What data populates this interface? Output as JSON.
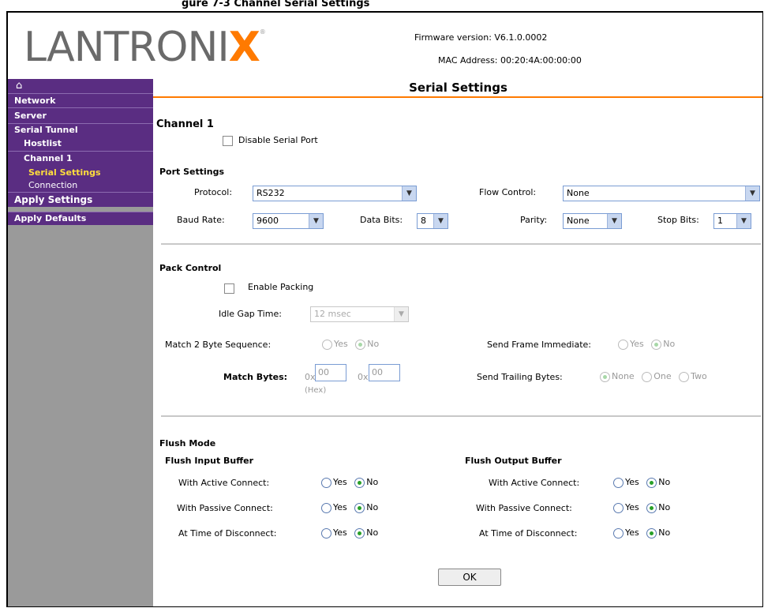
{
  "caption": "gure 7-3 Channel Serial Settings",
  "header": {
    "logo_text": "LANTRONI",
    "logo_x": "X",
    "logo_reg": "®",
    "firmware": "Firmware version: V6.1.0.0002",
    "mac": "MAC Address: 00:20:4A:00:00:00"
  },
  "sidebar": {
    "home_icon": "⌂",
    "items": [
      {
        "label": "Network",
        "level": 0
      },
      {
        "label": "Server",
        "level": 0
      },
      {
        "label": "Serial Tunnel",
        "level": 0
      },
      {
        "label": "Hostlist",
        "level": 1
      },
      {
        "label": "Channel 1",
        "level": 1
      },
      {
        "label": "Serial Settings",
        "level": 2
      },
      {
        "label": "Connection",
        "level": 2
      },
      {
        "label": "Apply Settings",
        "level": 0
      },
      {
        "label": "Apply Defaults",
        "level": 0
      }
    ]
  },
  "page": {
    "title": "Serial Settings",
    "channel": "Channel 1",
    "disable_serial_port": "Disable Serial Port",
    "port_settings": {
      "heading": "Port Settings",
      "protocol_label": "Protocol:",
      "protocol_value": "RS232",
      "flow_label": "Flow Control:",
      "flow_value": "None",
      "baud_label": "Baud Rate:",
      "baud_value": "9600",
      "databits_label": "Data Bits:",
      "databits_value": "8",
      "parity_label": "Parity:",
      "parity_value": "None",
      "stopbits_label": "Stop Bits:",
      "stopbits_value": "1"
    },
    "pack_control": {
      "heading": "Pack Control",
      "enable_packing": "Enable Packing",
      "idle_gap_label": "Idle Gap Time:",
      "idle_gap_value": "12 msec",
      "match_seq_label": "Match 2 Byte Sequence:",
      "yes": "Yes",
      "no": "No",
      "send_frame_label": "Send Frame Immediate:",
      "match_bytes_label": "Match Bytes:",
      "match_bytes_v1": "0x",
      "match_bytes_in1": "00",
      "match_bytes_v2": "0x",
      "match_bytes_in2": "00",
      "match_bytes_hex": "(Hex)",
      "send_trailing_label": "Send Trailing Bytes:",
      "none": "None",
      "one": "One",
      "two": "Two"
    },
    "flush_mode": {
      "heading": "Flush Mode",
      "input_heading": "Flush Input Buffer",
      "output_heading": "Flush Output Buffer",
      "input_rows": [
        {
          "label": "With Active Connect:",
          "yes": "Yes",
          "no": "No"
        },
        {
          "label": "With Passive Connect:",
          "yes": "Yes",
          "no": "No"
        },
        {
          "label": "At Time of Disconnect:",
          "yes": "Yes",
          "no": "No"
        }
      ],
      "output_rows": [
        {
          "label": "With Active Connect:",
          "yes": "Yes",
          "no": "No"
        },
        {
          "label": "With Passive Connect:",
          "yes": "Yes",
          "no": "No"
        },
        {
          "label": "At Time of Disconnect:",
          "yes": "Yes",
          "no": "No"
        }
      ]
    },
    "ok_button": "OK"
  }
}
